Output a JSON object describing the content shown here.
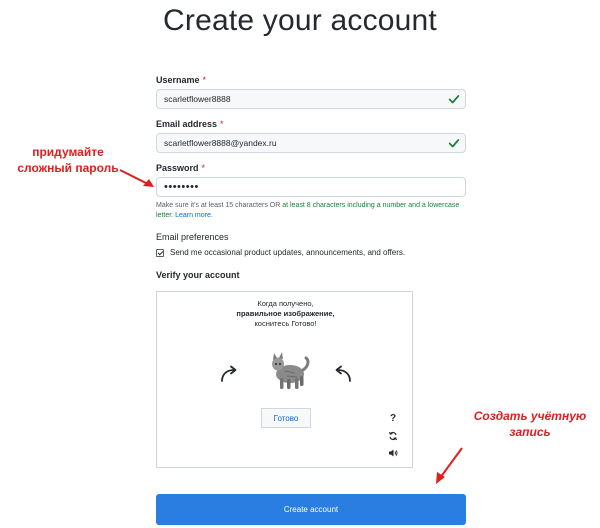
{
  "page": {
    "title": "Create your account"
  },
  "form": {
    "username": {
      "label": "Username",
      "required": "*",
      "value": "scarletflower8888"
    },
    "email": {
      "label": "Email address",
      "required": "*",
      "value": "scarletflower8888@yandex.ru"
    },
    "password": {
      "label": "Password",
      "required": "*",
      "value": "••••••••"
    },
    "password_hint": {
      "prefix": "Make sure it's at least 15 characters OR ",
      "green": "at least 8 characters including a number and a lowercase letter.",
      "link": "Learn more."
    },
    "preferences": {
      "title": "Email preferences",
      "checkbox_label": "Send me occasional product updates, announcements, and offers.",
      "checked": true
    },
    "verify_title": "Verify your account",
    "submit_label": "Create account"
  },
  "captcha": {
    "line1": "Когда получено,",
    "line2": "правильное изображение,",
    "line3": "коснитесь Готово!",
    "done_label": "Готово",
    "help_glyph": "?",
    "icons": [
      "help-icon",
      "refresh-icon",
      "audio-icon"
    ]
  },
  "annotations": {
    "left_line1": "придумайте",
    "left_line2": "сложный пароль",
    "right_line1": "Создать учётную",
    "right_line2": "запись",
    "color": "#e01e1e"
  },
  "colors": {
    "accent": "#2a7de1",
    "valid": "#1a7f37",
    "link": "#0969da",
    "required": "#cf222e"
  }
}
